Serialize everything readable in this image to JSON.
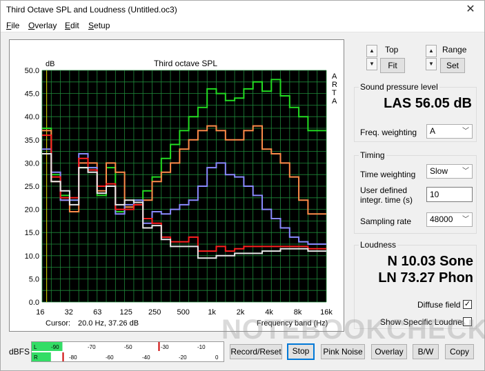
{
  "window": {
    "title": "Third Octave SPL and Loudness (Untitled.oc3)",
    "close_glyph": "✕"
  },
  "menu": [
    "File",
    "Overlay",
    "Edit",
    "Setup"
  ],
  "menu_underline": [
    "F",
    "O",
    "E",
    "S"
  ],
  "menu_rest": [
    "ile",
    "verlay",
    "dit",
    "etup"
  ],
  "plot": {
    "y_unit": "dB",
    "title": "Third octave SPL",
    "side_letters": [
      "A",
      "R",
      "T",
      "A"
    ],
    "cursor_label": "Cursor:",
    "cursor_value": "20.0 Hz, 37.26 dB",
    "x_axis_label": "Frequency band (Hz)"
  },
  "chart_data": {
    "type": "line",
    "title": "Third octave SPL",
    "xlabel": "Frequency band (Hz)",
    "ylabel": "dB",
    "ylim": [
      0,
      50
    ],
    "y_ticks": [
      "50.0",
      "45.0",
      "40.0",
      "35.0",
      "30.0",
      "25.0",
      "20.0",
      "15.0",
      "10.0",
      "5.0",
      "0.0"
    ],
    "x_ticks": [
      "16",
      "32",
      "63",
      "125",
      "250",
      "500",
      "1k",
      "2k",
      "4k",
      "8k",
      "16k"
    ],
    "bands": [
      "20",
      "25",
      "31.5",
      "40",
      "50",
      "63",
      "80",
      "100",
      "125",
      "160",
      "200",
      "250",
      "315",
      "400",
      "500",
      "630",
      "800",
      "1k",
      "1.25k",
      "1.6k",
      "2k",
      "2.5k",
      "3.15k",
      "4k",
      "5k",
      "6.3k",
      "8k",
      "10k",
      "12.5k",
      "16k",
      "20k"
    ],
    "grid": true,
    "background": "#000000",
    "grid_color": "#1f8a3a",
    "series": [
      {
        "color": "#22dd22",
        "values": [
          37.5,
          27.5,
          23,
          22,
          29,
          29,
          23,
          29,
          19.5,
          20.5,
          22,
          24,
          27,
          31,
          34,
          37,
          40,
          42,
          46,
          45,
          43.5,
          44,
          46,
          47.5,
          45.5,
          48,
          44.5,
          42,
          40,
          37,
          37
        ]
      },
      {
        "color": "#ff8c4a",
        "values": [
          37,
          26,
          22,
          19.5,
          30,
          30,
          24,
          30,
          28,
          20.5,
          21,
          22,
          26,
          28,
          30,
          33,
          35,
          37,
          38,
          37,
          35,
          35,
          37,
          38,
          33,
          32,
          30,
          27,
          22,
          19,
          19
        ]
      },
      {
        "color": "#8a8aff",
        "values": [
          33,
          28,
          22,
          22,
          32,
          29,
          25,
          25,
          19,
          21,
          22,
          17,
          19.5,
          19,
          20,
          21,
          22,
          25,
          29,
          30,
          27.5,
          27,
          25,
          23,
          20,
          18,
          16,
          14,
          13,
          12.5,
          12.5
        ]
      },
      {
        "color": "#ff2020",
        "values": [
          36,
          27,
          22.5,
          22.5,
          31,
          28.5,
          25,
          25.5,
          20,
          20,
          21,
          18,
          17,
          14,
          13,
          13,
          14,
          11,
          11,
          12,
          11,
          11.5,
          12,
          12,
          12,
          12,
          12,
          12,
          12,
          11.5,
          11.5
        ]
      },
      {
        "color": "#e8e8e8",
        "values": [
          32,
          26,
          24,
          21,
          29,
          28,
          23.5,
          25,
          21,
          22,
          21.5,
          16,
          16.5,
          13.5,
          12,
          12,
          12,
          9.5,
          9.5,
          10,
          10,
          10.5,
          10.5,
          10.5,
          11,
          11,
          11.5,
          11.5,
          11.5,
          11,
          11
        ]
      }
    ]
  },
  "right": {
    "top_label": "Top",
    "fit_label": "Fit",
    "range_label": "Range",
    "set_label": "Set",
    "spl_group": "Sound pressure level",
    "spl_value": "LAS 56.05 dB",
    "freq_weighting_label": "Freq. weighting",
    "freq_weighting_value": "A",
    "timing_group": "Timing",
    "time_weighting_label": "Time weighting",
    "time_weighting_value": "Slow",
    "integr_label_1": "User defined",
    "integr_label_2": "integr. time (s)",
    "integr_value": "10",
    "sampling_label": "Sampling rate",
    "sampling_value": "48000",
    "loudness_group": "Loudness",
    "loudness_n": "N 10.03 Sone",
    "loudness_ln": "LN 73.27 Phon",
    "diffuse_label": "Diffuse field",
    "specific_label": "Show Specific Loudness"
  },
  "bottom": {
    "dbfs_label": "dBFS",
    "meter_l": "L",
    "meter_r": "R",
    "meter_top_ticks": [
      "-90",
      "-70",
      "-50",
      "-30",
      "-10"
    ],
    "meter_bottom_ticks": [
      "-80",
      "-60",
      "-40",
      "-20",
      "0"
    ],
    "meter_l_level": 0.16,
    "meter_r_level": 0.1,
    "meter_l_peak": 0.66,
    "meter_r_peak": 0.16,
    "record_label": "Record/Reset",
    "stop_label": "Stop",
    "pink_label": "Pink Noise",
    "overlay_label": "Overlay",
    "bw_label": "B/W",
    "copy_label": "Copy"
  },
  "watermark": "NOTEBOOKCHECK"
}
